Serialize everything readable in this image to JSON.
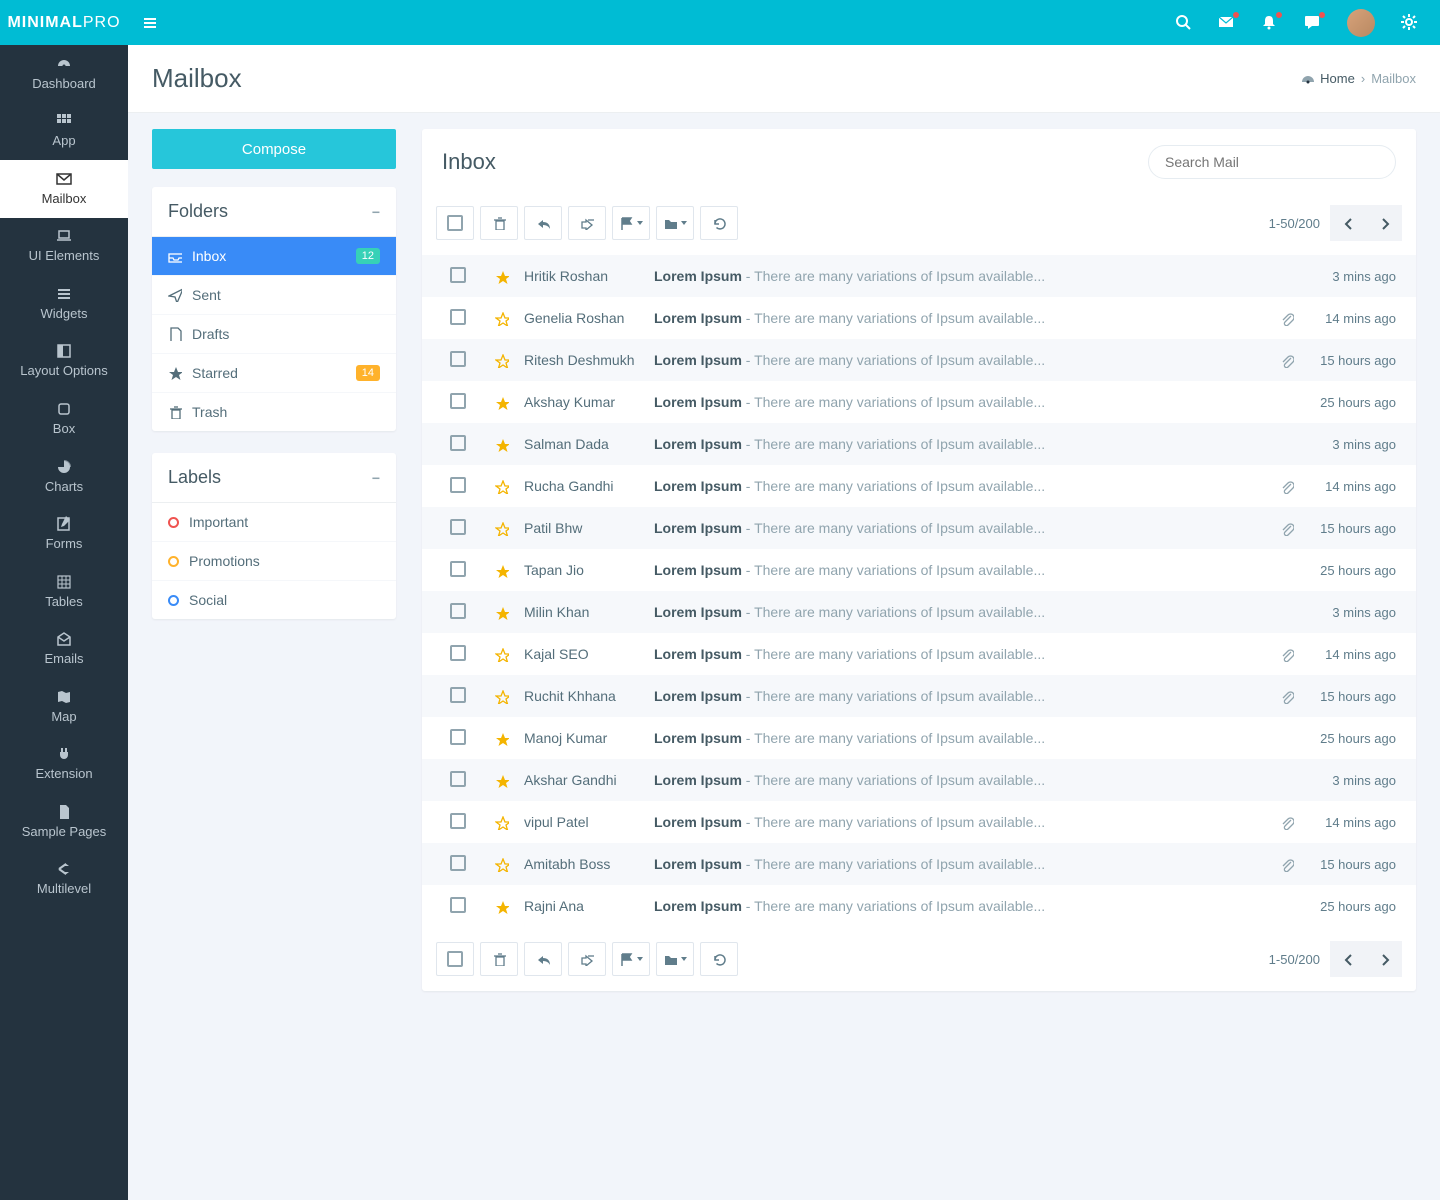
{
  "brand": {
    "a": "MINIMAL",
    "b": "PRO"
  },
  "header_icons": [
    "search",
    "mail",
    "bell",
    "chat",
    "avatar",
    "gear"
  ],
  "sidebar": [
    {
      "label": "Dashboard",
      "icon": "dashboard"
    },
    {
      "label": "App",
      "icon": "grid"
    },
    {
      "label": "Mailbox",
      "icon": "mail",
      "active": true
    },
    {
      "label": "UI Elements",
      "icon": "laptop"
    },
    {
      "label": "Widgets",
      "icon": "bars"
    },
    {
      "label": "Layout Options",
      "icon": "layout"
    },
    {
      "label": "Box",
      "icon": "box"
    },
    {
      "label": "Charts",
      "icon": "pie"
    },
    {
      "label": "Forms",
      "icon": "edit"
    },
    {
      "label": "Tables",
      "icon": "table"
    },
    {
      "label": "Emails",
      "icon": "envelope-open"
    },
    {
      "label": "Map",
      "icon": "map"
    },
    {
      "label": "Extension",
      "icon": "plug"
    },
    {
      "label": "Sample Pages",
      "icon": "file"
    },
    {
      "label": "Multilevel",
      "icon": "share"
    }
  ],
  "page": {
    "title": "Mailbox",
    "home": "Home",
    "crumb": "Mailbox"
  },
  "compose": "Compose",
  "folders": {
    "title": "Folders",
    "items": [
      {
        "label": "Inbox",
        "icon": "inbox",
        "badge": "12",
        "bclass": "bg-info",
        "active": true
      },
      {
        "label": "Sent",
        "icon": "send"
      },
      {
        "label": "Drafts",
        "icon": "file"
      },
      {
        "label": "Starred",
        "icon": "star",
        "badge": "14",
        "bclass": "bg-warn"
      },
      {
        "label": "Trash",
        "icon": "trash"
      }
    ]
  },
  "labels": {
    "title": "Labels",
    "items": [
      {
        "label": "Important",
        "cls": "lbl-red"
      },
      {
        "label": "Promotions",
        "cls": "lbl-yellow"
      },
      {
        "label": "Social",
        "cls": "lbl-blue"
      }
    ]
  },
  "inbox": {
    "title": "Inbox",
    "search_ph": "Search Mail",
    "page": "1-50/200"
  },
  "subject_prefix": "Lorem Ipsum",
  "subject_rest": " - There are many variations of Ipsum available...",
  "mails": [
    {
      "sender": "Hritik Roshan",
      "star": true,
      "attach": false,
      "time": "3 mins ago"
    },
    {
      "sender": "Genelia Roshan",
      "star": false,
      "attach": true,
      "time": "14 mins ago"
    },
    {
      "sender": "Ritesh Deshmukh",
      "star": false,
      "attach": true,
      "time": "15 hours ago"
    },
    {
      "sender": "Akshay Kumar",
      "star": true,
      "attach": false,
      "time": "25 hours ago"
    },
    {
      "sender": "Salman Dada",
      "star": true,
      "attach": false,
      "time": "3 mins ago"
    },
    {
      "sender": "Rucha Gandhi",
      "star": false,
      "attach": true,
      "time": "14 mins ago"
    },
    {
      "sender": "Patil Bhw",
      "star": false,
      "attach": true,
      "time": "15 hours ago"
    },
    {
      "sender": "Tapan Jio",
      "star": true,
      "attach": false,
      "time": "25 hours ago"
    },
    {
      "sender": "Milin Khan",
      "star": true,
      "attach": false,
      "time": "3 mins ago"
    },
    {
      "sender": "Kajal SEO",
      "star": false,
      "attach": true,
      "time": "14 mins ago"
    },
    {
      "sender": "Ruchit Khhana",
      "star": false,
      "attach": true,
      "time": "15 hours ago"
    },
    {
      "sender": "Manoj Kumar",
      "star": true,
      "attach": false,
      "time": "25 hours ago"
    },
    {
      "sender": "Akshar Gandhi",
      "star": true,
      "attach": false,
      "time": "3 mins ago"
    },
    {
      "sender": "vipul Patel",
      "star": false,
      "attach": true,
      "time": "14 mins ago"
    },
    {
      "sender": "Amitabh Boss",
      "star": false,
      "attach": true,
      "time": "15 hours ago"
    },
    {
      "sender": "Rajni Ana",
      "star": true,
      "attach": false,
      "time": "25 hours ago"
    }
  ]
}
